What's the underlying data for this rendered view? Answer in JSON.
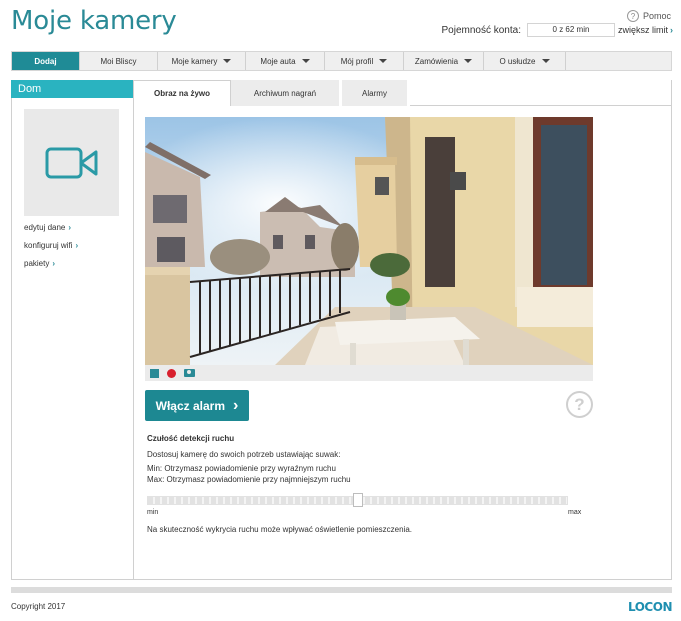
{
  "header": {
    "title": "Moje kamery",
    "help_label": "Pomoc",
    "quota_label": "Pojemność konta:",
    "quota_value": "0 z 62 min",
    "quota_link": "zwiększ limit"
  },
  "nav": {
    "items": [
      {
        "label": "Dodaj",
        "active": true,
        "dropdown": false
      },
      {
        "label": "Moi Bliscy",
        "active": false,
        "dropdown": false
      },
      {
        "label": "Moje kamery",
        "active": false,
        "dropdown": true
      },
      {
        "label": "Moje auta",
        "active": false,
        "dropdown": true
      },
      {
        "label": "Mój profil",
        "active": false,
        "dropdown": true
      },
      {
        "label": "Zamówienia",
        "active": false,
        "dropdown": true
      },
      {
        "label": "O usłudze",
        "active": false,
        "dropdown": true
      }
    ]
  },
  "sidebar": {
    "title": "Dom",
    "thumbnail_icon": "video-camera-icon",
    "links": [
      "edytuj dane",
      "konfiguruj wifi",
      "pakiety"
    ]
  },
  "tabs": [
    {
      "label": "Obraz na żywo",
      "active": true
    },
    {
      "label": "Archiwum nagrań",
      "active": false
    },
    {
      "label": "Alarmy",
      "active": false
    }
  ],
  "video": {
    "controls": [
      "stop-icon",
      "record-icon",
      "snapshot-icon"
    ]
  },
  "alarm": {
    "button_label": "Włącz alarm",
    "help_glyph": "?"
  },
  "sensitivity": {
    "title": "Czułość detekcji ruchu",
    "description": "Dostosuj kamerę do swoich potrzeb ustawiając suwak:",
    "min_text": "Min: Otrzymasz powiadomienie przy wyraźnym ruchu",
    "max_text": "Max: Otrzymasz powiadomienie przy najmniejszym ruchu",
    "min_label": "min",
    "max_label": "max",
    "value_fraction": 0.5,
    "note": "Na skuteczność wykrycia ruchu może wpływać oświetlenie pomieszczenia."
  },
  "footer": {
    "copyright": "Copyright 2017",
    "logo": "LOCON"
  },
  "colors": {
    "accent": "#1f8b96",
    "sidebar_header": "#2ab3c0",
    "record": "#d8202e"
  }
}
